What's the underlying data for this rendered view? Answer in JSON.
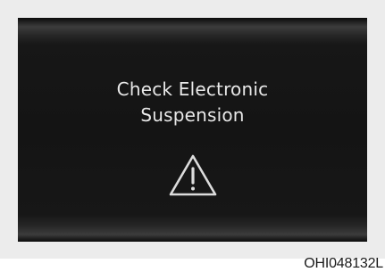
{
  "display": {
    "message_line1": "Check Electronic",
    "message_line2": "Suspension",
    "warning_icon": "warning-triangle-icon"
  },
  "figure_code": "OHI048132L",
  "colors": {
    "screen_background": "#141414",
    "message_text": "#e8e8e8",
    "frame": "#ececec"
  }
}
